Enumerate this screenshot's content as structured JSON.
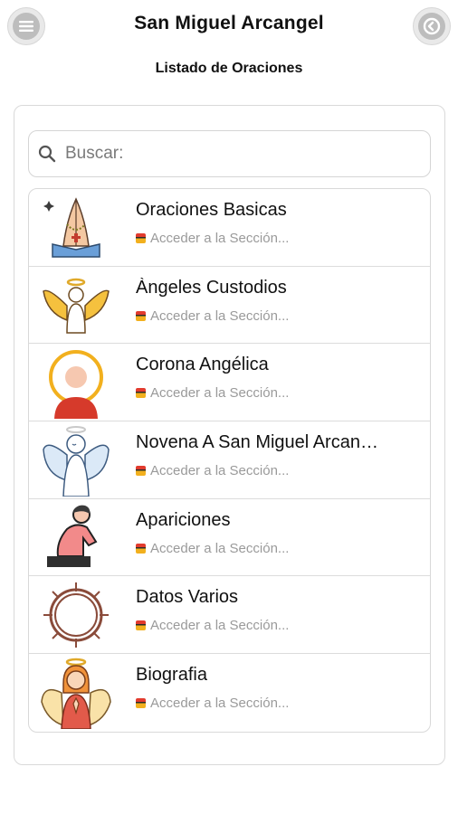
{
  "header": {
    "title": "San Miguel Arcangel",
    "subtitle": "Listado de Oraciones",
    "menu_icon": "menu-icon",
    "back_icon": "back-arrow-icon"
  },
  "search": {
    "placeholder": "Buscar:",
    "icon": "search-icon"
  },
  "items": [
    {
      "title": "Oraciones Basicas",
      "subtitle": "Acceder a la Sección...",
      "icon": "praying-hands-rosary-icon"
    },
    {
      "title": "Àngeles Custodios",
      "subtitle": "Acceder a la Sección...",
      "icon": "angel-wings-icon"
    },
    {
      "title": "Corona Angélica",
      "subtitle": "Acceder a la Sección...",
      "icon": "saint-halo-icon"
    },
    {
      "title": "Novena A San Miguel Arcan…",
      "subtitle": "Acceder a la Sección...",
      "icon": "angel-icon"
    },
    {
      "title": "Apariciones",
      "subtitle": "Acceder a la Sección...",
      "icon": "kneeling-person-praying-icon"
    },
    {
      "title": "Datos Varios",
      "subtitle": "Acceder a la Sección...",
      "icon": "crown-of-thorns-icon"
    },
    {
      "title": "Biografia",
      "subtitle": "Acceder a la Sección...",
      "icon": "praying-angel-girl-icon"
    }
  ],
  "colors": {
    "panel_border": "#d9d9d9",
    "subtitle_text": "#9a9a9a",
    "button_gray": "#bdbdbd"
  }
}
